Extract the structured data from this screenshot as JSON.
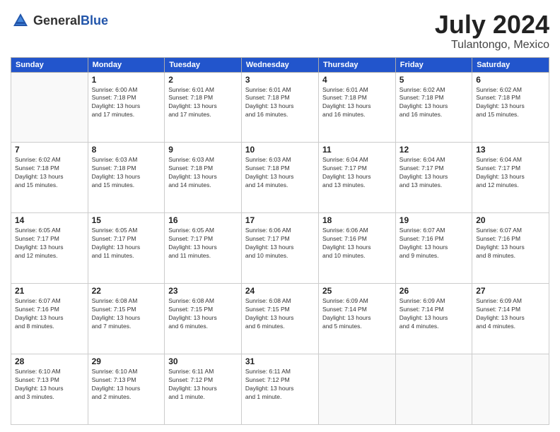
{
  "header": {
    "logo": {
      "general": "General",
      "blue": "Blue"
    },
    "title": "July 2024",
    "location": "Tulantongo, Mexico"
  },
  "days_of_week": [
    "Sunday",
    "Monday",
    "Tuesday",
    "Wednesday",
    "Thursday",
    "Friday",
    "Saturday"
  ],
  "weeks": [
    [
      {
        "day": "",
        "info": ""
      },
      {
        "day": "1",
        "info": "Sunrise: 6:00 AM\nSunset: 7:18 PM\nDaylight: 13 hours\nand 17 minutes."
      },
      {
        "day": "2",
        "info": "Sunrise: 6:01 AM\nSunset: 7:18 PM\nDaylight: 13 hours\nand 17 minutes."
      },
      {
        "day": "3",
        "info": "Sunrise: 6:01 AM\nSunset: 7:18 PM\nDaylight: 13 hours\nand 16 minutes."
      },
      {
        "day": "4",
        "info": "Sunrise: 6:01 AM\nSunset: 7:18 PM\nDaylight: 13 hours\nand 16 minutes."
      },
      {
        "day": "5",
        "info": "Sunrise: 6:02 AM\nSunset: 7:18 PM\nDaylight: 13 hours\nand 16 minutes."
      },
      {
        "day": "6",
        "info": "Sunrise: 6:02 AM\nSunset: 7:18 PM\nDaylight: 13 hours\nand 15 minutes."
      }
    ],
    [
      {
        "day": "7",
        "info": "Sunrise: 6:02 AM\nSunset: 7:18 PM\nDaylight: 13 hours\nand 15 minutes."
      },
      {
        "day": "8",
        "info": "Sunrise: 6:03 AM\nSunset: 7:18 PM\nDaylight: 13 hours\nand 15 minutes."
      },
      {
        "day": "9",
        "info": "Sunrise: 6:03 AM\nSunset: 7:18 PM\nDaylight: 13 hours\nand 14 minutes."
      },
      {
        "day": "10",
        "info": "Sunrise: 6:03 AM\nSunset: 7:18 PM\nDaylight: 13 hours\nand 14 minutes."
      },
      {
        "day": "11",
        "info": "Sunrise: 6:04 AM\nSunset: 7:17 PM\nDaylight: 13 hours\nand 13 minutes."
      },
      {
        "day": "12",
        "info": "Sunrise: 6:04 AM\nSunset: 7:17 PM\nDaylight: 13 hours\nand 13 minutes."
      },
      {
        "day": "13",
        "info": "Sunrise: 6:04 AM\nSunset: 7:17 PM\nDaylight: 13 hours\nand 12 minutes."
      }
    ],
    [
      {
        "day": "14",
        "info": "Sunrise: 6:05 AM\nSunset: 7:17 PM\nDaylight: 13 hours\nand 12 minutes."
      },
      {
        "day": "15",
        "info": "Sunrise: 6:05 AM\nSunset: 7:17 PM\nDaylight: 13 hours\nand 11 minutes."
      },
      {
        "day": "16",
        "info": "Sunrise: 6:05 AM\nSunset: 7:17 PM\nDaylight: 13 hours\nand 11 minutes."
      },
      {
        "day": "17",
        "info": "Sunrise: 6:06 AM\nSunset: 7:17 PM\nDaylight: 13 hours\nand 10 minutes."
      },
      {
        "day": "18",
        "info": "Sunrise: 6:06 AM\nSunset: 7:16 PM\nDaylight: 13 hours\nand 10 minutes."
      },
      {
        "day": "19",
        "info": "Sunrise: 6:07 AM\nSunset: 7:16 PM\nDaylight: 13 hours\nand 9 minutes."
      },
      {
        "day": "20",
        "info": "Sunrise: 6:07 AM\nSunset: 7:16 PM\nDaylight: 13 hours\nand 8 minutes."
      }
    ],
    [
      {
        "day": "21",
        "info": "Sunrise: 6:07 AM\nSunset: 7:16 PM\nDaylight: 13 hours\nand 8 minutes."
      },
      {
        "day": "22",
        "info": "Sunrise: 6:08 AM\nSunset: 7:15 PM\nDaylight: 13 hours\nand 7 minutes."
      },
      {
        "day": "23",
        "info": "Sunrise: 6:08 AM\nSunset: 7:15 PM\nDaylight: 13 hours\nand 6 minutes."
      },
      {
        "day": "24",
        "info": "Sunrise: 6:08 AM\nSunset: 7:15 PM\nDaylight: 13 hours\nand 6 minutes."
      },
      {
        "day": "25",
        "info": "Sunrise: 6:09 AM\nSunset: 7:14 PM\nDaylight: 13 hours\nand 5 minutes."
      },
      {
        "day": "26",
        "info": "Sunrise: 6:09 AM\nSunset: 7:14 PM\nDaylight: 13 hours\nand 4 minutes."
      },
      {
        "day": "27",
        "info": "Sunrise: 6:09 AM\nSunset: 7:14 PM\nDaylight: 13 hours\nand 4 minutes."
      }
    ],
    [
      {
        "day": "28",
        "info": "Sunrise: 6:10 AM\nSunset: 7:13 PM\nDaylight: 13 hours\nand 3 minutes."
      },
      {
        "day": "29",
        "info": "Sunrise: 6:10 AM\nSunset: 7:13 PM\nDaylight: 13 hours\nand 2 minutes."
      },
      {
        "day": "30",
        "info": "Sunrise: 6:11 AM\nSunset: 7:12 PM\nDaylight: 13 hours\nand 1 minute."
      },
      {
        "day": "31",
        "info": "Sunrise: 6:11 AM\nSunset: 7:12 PM\nDaylight: 13 hours\nand 1 minute."
      },
      {
        "day": "",
        "info": ""
      },
      {
        "day": "",
        "info": ""
      },
      {
        "day": "",
        "info": ""
      }
    ]
  ]
}
